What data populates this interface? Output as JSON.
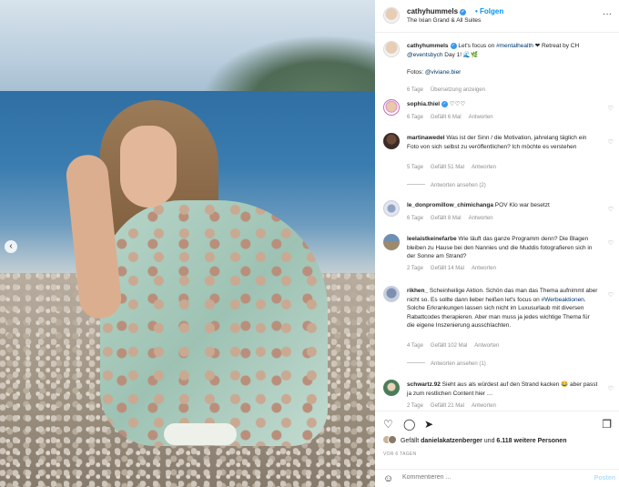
{
  "post": {
    "author": "cathyhummels",
    "follow_label": "Folgen",
    "location": "The Ixian Grand & All Suites",
    "more_icon": "···"
  },
  "caption": {
    "author": "cathyhummels",
    "text_pre": " Let's focus on ",
    "hashtag": "#mentalhealth",
    "text_mid": " ❤ Retreat by CH ",
    "mention": "@eventsbych",
    "text_post": " Day 1! 🌊🌿",
    "photo_credit_label": "Fotos: ",
    "photo_credit": "@viviane.bier",
    "age": "6 Tage",
    "translate": "Übersetzung anzeigen"
  },
  "comments": [
    {
      "user": "sophia.thiel",
      "text": " ♡♡♡",
      "age": "6 Tage",
      "likes": "Gefällt 6 Mal",
      "reply": "Antworten"
    },
    {
      "user": "martinawedel",
      "text": " Was ist der Sinn / die Motivation, jahrelang täglich ein Foto von sich selbst zu veröffentlichen? Ich möchte es verstehen",
      "age": "5 Tage",
      "likes": "Gefällt 51 Mal",
      "reply": "Antworten",
      "replies": "Antworten ansehen (2)"
    },
    {
      "user": "le_donpromillow_chimichanga",
      "text": " POV Klo war besetzt",
      "age": "6 Tage",
      "likes": "Gefällt 8 Mal",
      "reply": "Antworten"
    },
    {
      "user": "leelaistkeinefarbe",
      "text": " Wie läuft das ganze Programm denn? Die Blagen bleiben zu Hause bei den Nannies und die Muddis fotografieren sich in der Sonne am Strand?",
      "age": "2 Tage",
      "likes": "Gefällt 14 Mal",
      "reply": "Antworten"
    },
    {
      "user": "rikhen_",
      "text_pre": " Scheinheilige Aktion. Schön das man das Thema aufnimmt aber nicht so. Es sollte dann lieber heißen let's focus on ",
      "hashtag": "#Werbeaktionen",
      "text_post": ". Solche Erkrankungen lassen sich nicht im Luxusurlaub mit diversen Rabattcodes therapieren. Aber man muss ja jedes wichtige Thema für die eigene Inszenierung ausschlachten.",
      "age": "4 Tage",
      "likes": "Gefällt 102 Mal",
      "reply": "Antworten",
      "replies": "Antworten ansehen (1)"
    },
    {
      "user": "schwartz.92",
      "text": " Sieht aus als würdest auf den Strand kacken 😂 aber passt ja zum restlichen Content hier …",
      "age": "2 Tage",
      "likes": "Gefällt 21 Mal",
      "reply": "Antworten"
    }
  ],
  "likes": {
    "prefix": "Gefällt ",
    "user": "danielakatzenberger",
    "middle": " und ",
    "count": "6.118 weitere Personen"
  },
  "date": "VOR 6 TAGEN",
  "add_comment": {
    "placeholder": "Kommentieren ...",
    "post_label": "Posten"
  },
  "icons": {
    "heart": "♡",
    "comment": "◯",
    "share": "➤",
    "save": "❐",
    "smile": "☺",
    "prev": "‹"
  }
}
